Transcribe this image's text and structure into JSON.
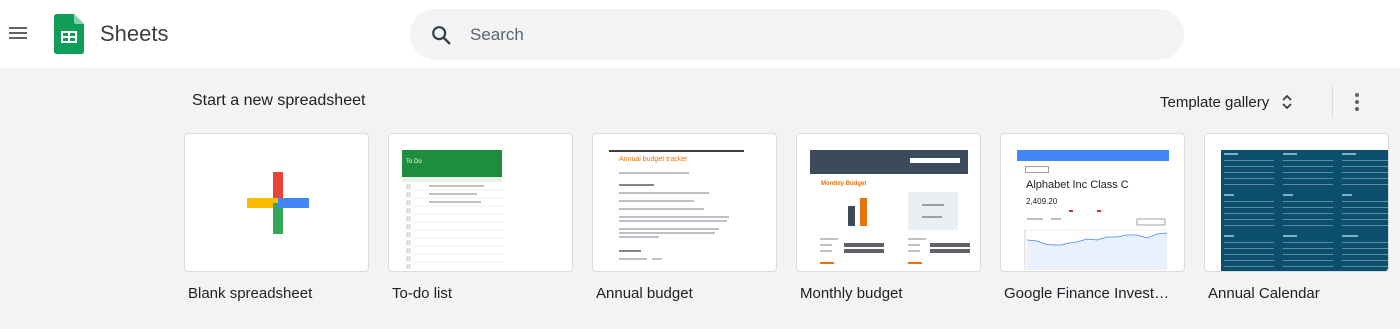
{
  "app": {
    "title": "Sheets"
  },
  "search": {
    "placeholder": "Search"
  },
  "section": {
    "title": "Start a new spreadsheet",
    "gallery_label": "Template gallery"
  },
  "templates": [
    {
      "label": "Blank spreadsheet"
    },
    {
      "label": "To-do list",
      "thumb_title": "To Do"
    },
    {
      "label": "Annual budget",
      "thumb_title": "Annual budget tracker"
    },
    {
      "label": "Monthly budget",
      "thumb_title": "Monthly Budget"
    },
    {
      "label": "Google Finance Invest…",
      "thumb_title": "Alphabet Inc Class C",
      "thumb_value": "2,409.20"
    },
    {
      "label": "Annual Calendar"
    }
  ],
  "colors": {
    "sheets_green": "#0f9d58",
    "todo_green": "#1e8e3e",
    "budget_orange": "#e8710a",
    "navy": "#0b4f6c",
    "finance_blue": "#4285f4"
  },
  "icons": [
    "menu-icon",
    "sheets-logo-icon",
    "search-icon",
    "unfold-icon",
    "more-vert-icon",
    "plus-icon"
  ]
}
